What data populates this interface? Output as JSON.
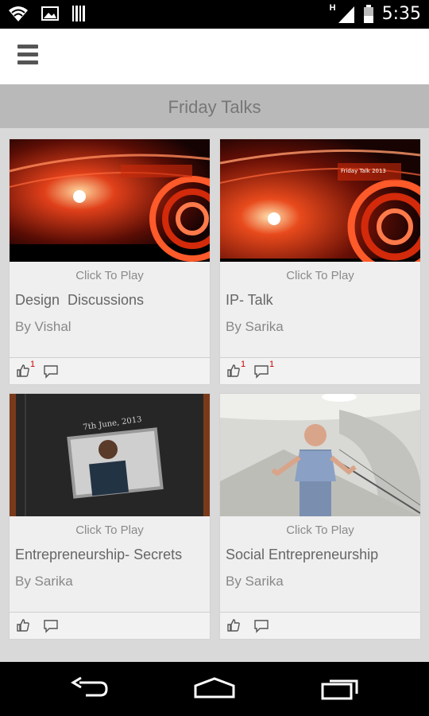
{
  "status_bar": {
    "time": "5:35",
    "network_type": "H",
    "icons": [
      "wifi-icon",
      "image-icon",
      "barcode-icon",
      "signal-icon",
      "battery-icon"
    ]
  },
  "action_bar": {
    "menu_icon": "hamburger-menu-icon"
  },
  "page": {
    "title": "Friday Talks"
  },
  "videos": [
    {
      "play_label": "Click To Play",
      "title": "Design  Discussions",
      "author": "By Vishal",
      "likes": "1",
      "comments": "",
      "thumb_caption": ""
    },
    {
      "play_label": "Click To Play",
      "title": "IP- Talk",
      "author": "By Sarika",
      "likes": "1",
      "comments": "1",
      "thumb_caption": "Friday Talk 2013"
    },
    {
      "play_label": "Click To Play",
      "title": "Entrepreneurship- Secrets",
      "author": "By Sarika",
      "likes": "",
      "comments": "",
      "thumb_caption": "7th June, 2013"
    },
    {
      "play_label": "Click To Play",
      "title": "Social Entrepreneurship",
      "author": "By Sarika",
      "likes": "",
      "comments": "",
      "thumb_caption": ""
    }
  ],
  "nav_bar": {
    "buttons": [
      "back-icon",
      "home-icon",
      "recent-apps-icon"
    ]
  },
  "colors": {
    "status_bar": "#000000",
    "action_bar": "#ffffff",
    "title_bar": "#b9b9b9",
    "background": "#d9d9d9",
    "badge": "#cc0000",
    "thumb_accent": "#e0401a"
  }
}
